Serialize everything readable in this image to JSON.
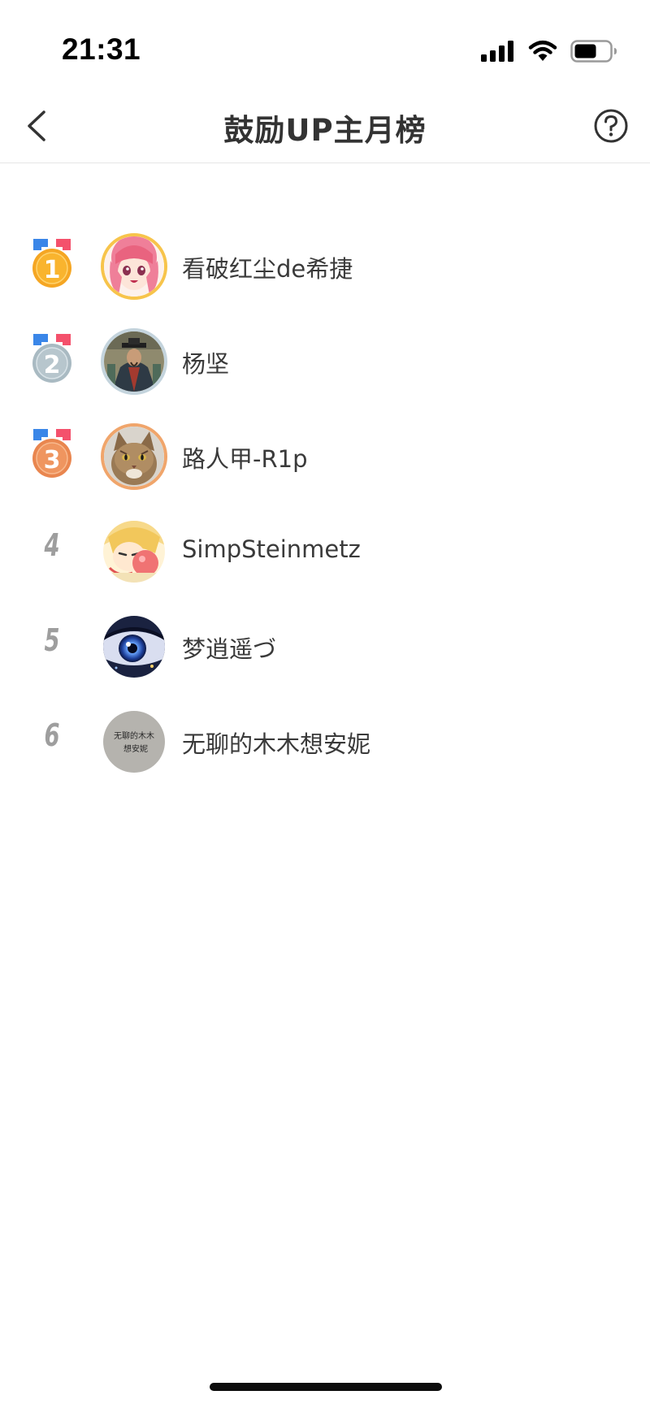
{
  "status_bar": {
    "time": "21:31",
    "icons": [
      "cellular-signal-icon",
      "wifi-icon",
      "battery-icon"
    ]
  },
  "nav": {
    "title": "鼓励UP主月榜",
    "back_icon": "chevron-left-icon",
    "help_icon": "question-circle-icon"
  },
  "colors": {
    "gold": "#f5a623",
    "silver": "#a9bac2",
    "bronze": "#e9864f",
    "rank_text": "#9e9e9e"
  },
  "ranking": [
    {
      "rank": "1",
      "name": "看破红尘de希捷",
      "medal": "gold-medal-icon"
    },
    {
      "rank": "2",
      "name": "杨坚",
      "medal": "silver-medal-icon"
    },
    {
      "rank": "3",
      "name": "路人甲-R1p",
      "medal": "bronze-medal-icon"
    },
    {
      "rank": "4",
      "name": "SimpSteinmetz"
    },
    {
      "rank": "5",
      "name": "梦逍遥づ"
    },
    {
      "rank": "6",
      "name": "无聊的木木想安妮",
      "avatar_text": "无聊的木木想安妮"
    }
  ]
}
